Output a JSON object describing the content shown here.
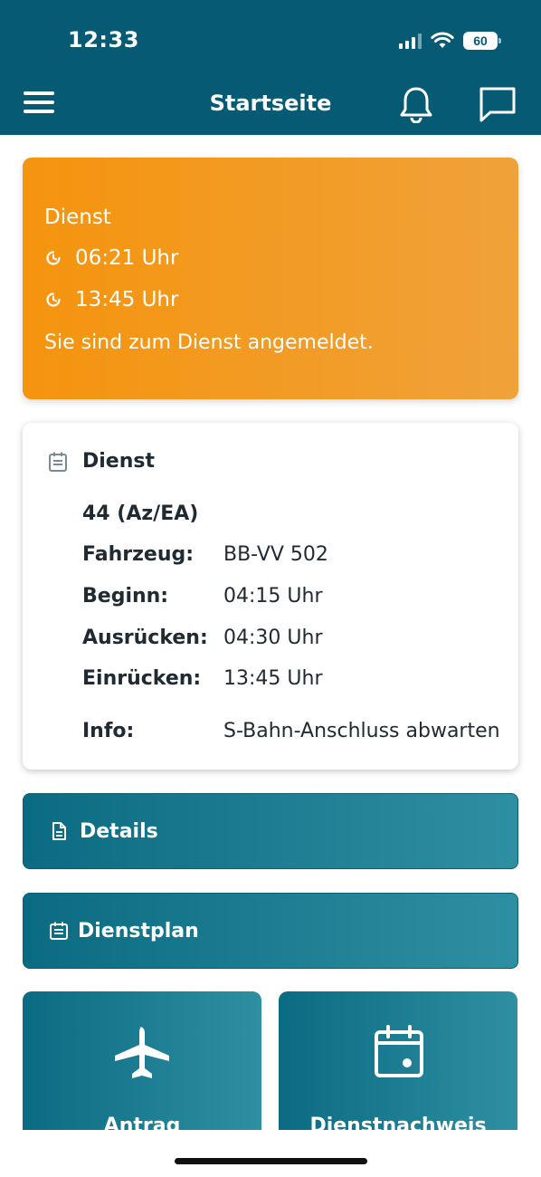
{
  "status_bar": {
    "time": "12:33",
    "battery": "60"
  },
  "header": {
    "title": "Startseite"
  },
  "alert": {
    "title": "Dienst",
    "time_start": "06:21 Uhr",
    "time_end": "13:45 Uhr",
    "message": "Sie sind zum Dienst angemeldet.",
    "color": "#f5940e"
  },
  "duty": {
    "title": "Dienst",
    "code": "44 (Az/EA)",
    "rows": [
      {
        "label": "Fahrzeug:",
        "value": "BB-VV 502"
      },
      {
        "label": "Beginn:",
        "value": "04:15 Uhr"
      },
      {
        "label": "Ausrücken:",
        "value": "04:30 Uhr"
      },
      {
        "label": "Einrücken:",
        "value": "13:45 Uhr"
      },
      {
        "label": "Info:",
        "value": "S-Bahn-Anschluss abwarten"
      }
    ]
  },
  "buttons": {
    "details": "Details",
    "dienstplan": "Dienstplan"
  },
  "tiles": {
    "antrag": "Antrag",
    "dienstnachweis": "Dienstnachweis"
  },
  "colors": {
    "primary": "#065a73",
    "teal_light": "#2f8fa2"
  }
}
